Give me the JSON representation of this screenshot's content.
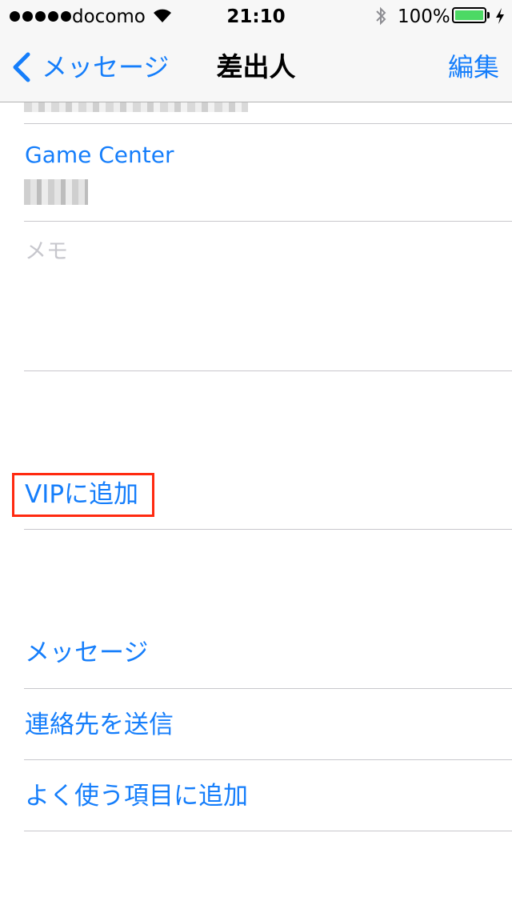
{
  "status_bar": {
    "carrier": "docomo",
    "time": "21:10",
    "battery_percent": "100%",
    "battery_level": 1.0,
    "icons": [
      "signal-dots-icon",
      "wifi-icon",
      "bluetooth-icon",
      "battery-icon",
      "charging-bolt-icon"
    ]
  },
  "nav": {
    "back_label": "メッセージ",
    "title": "差出人",
    "edit_label": "編集"
  },
  "contact": {
    "game_center_label": "Game Center",
    "memo_label": "メモ"
  },
  "actions": {
    "add_vip": "VIPに追加",
    "message": "メッセージ",
    "send_contact": "連絡先を送信",
    "add_favorites": "よく使う項目に追加"
  },
  "colors": {
    "accent": "#157efb",
    "highlight": "#ff2a10",
    "placeholder": "#c7c7cd",
    "separator": "#c8c7cc"
  }
}
